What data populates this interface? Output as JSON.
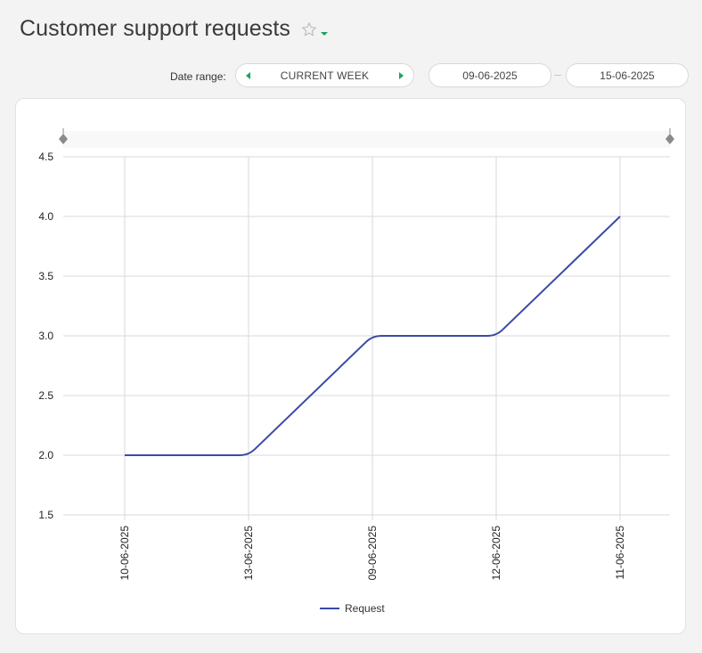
{
  "header": {
    "title": "Customer support requests"
  },
  "filters": {
    "date_range_label": "Date range:",
    "range_value": "CURRENT WEEK",
    "start_date": "09-06-2025",
    "end_date": "15-06-2025"
  },
  "colors": {
    "accent": "#1aa260",
    "series_line": "#3a4aa6",
    "grid": "#d8d8d8"
  },
  "chart_data": {
    "type": "line",
    "categories": [
      "10-06-2025",
      "13-06-2025",
      "09-06-2025",
      "12-06-2025",
      "11-06-2025"
    ],
    "series": [
      {
        "name": "Request",
        "values": [
          2,
          2,
          3,
          3,
          4
        ]
      }
    ],
    "ylim": [
      1.5,
      4.5
    ],
    "yticks": [
      "4.5",
      "4.0",
      "3.5",
      "3.0",
      "2.5",
      "2.0",
      "1.5"
    ],
    "grid": true,
    "legend": "bottom-center"
  }
}
